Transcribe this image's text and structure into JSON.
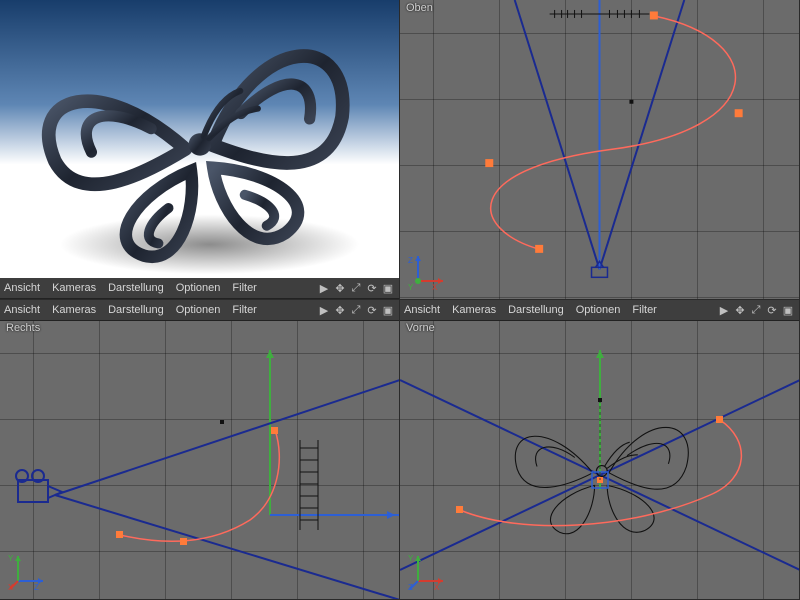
{
  "menus": {
    "view": "Ansicht",
    "cameras": "Kameras",
    "display": "Darstellung",
    "options": "Optionen",
    "filter": "Filter"
  },
  "viewports": {
    "top_left": {
      "label": "",
      "type": "Render"
    },
    "top_right": {
      "label": "Oben",
      "type": "Top"
    },
    "bottom_left": {
      "label": "Rechts",
      "type": "Right"
    },
    "bottom_right": {
      "label": "Vorne",
      "type": "Front"
    }
  },
  "axis_colors": {
    "x": "#d43c2f",
    "y": "#3fae3f",
    "z": "#2d5fd4"
  },
  "spline_color": "#ff6a5c",
  "handle_color": "#ff7b3a",
  "object": "butterfly-logo"
}
